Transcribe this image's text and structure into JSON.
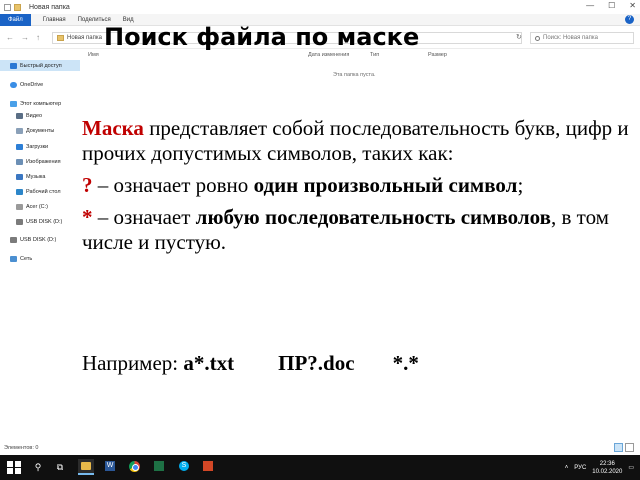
{
  "window": {
    "title": "Новая папка",
    "controls": {
      "minimize": "—",
      "maximize": "☐",
      "close": "✕"
    }
  },
  "ribbon": {
    "tabs": [
      "Файл",
      "Главная",
      "Поделиться",
      "Вид"
    ],
    "help": "?"
  },
  "address": {
    "path": "Новая папка",
    "search_placeholder": "Поиск: Новая папка"
  },
  "navpane": {
    "items": [
      {
        "label": "Быстрый доступ",
        "icon": "star-icon",
        "selected": true
      },
      {
        "label": "OneDrive",
        "icon": "cloud-icon"
      },
      {
        "label": "Этот компьютер",
        "icon": "computer-icon"
      },
      {
        "label": "Видео",
        "icon": "video-icon"
      },
      {
        "label": "Документы",
        "icon": "documents-icon"
      },
      {
        "label": "Загрузки",
        "icon": "downloads-icon"
      },
      {
        "label": "Изображения",
        "icon": "pictures-icon"
      },
      {
        "label": "Музыка",
        "icon": "music-icon"
      },
      {
        "label": "Рабочий стол",
        "icon": "desktop-icon"
      },
      {
        "label": "Acer (C:)",
        "icon": "disk-icon"
      },
      {
        "label": "USB DISK (D:)",
        "icon": "usb-icon"
      },
      {
        "label": "USB DISK (D:)",
        "icon": "usb-icon"
      },
      {
        "label": "Сеть",
        "icon": "network-icon"
      }
    ]
  },
  "filelist": {
    "columns": [
      "Имя",
      "Дата изменения",
      "Тип",
      "Размер"
    ],
    "empty_message": "Эта папка пуста."
  },
  "statusbar": {
    "text": "Элементов: 0"
  },
  "taskbar": {
    "tray_lang": "РУС",
    "time": "22:36",
    "date": "10.02.2020"
  },
  "slide": {
    "title": "Поиск файла по маске",
    "para1_term": "Маска",
    "para1_text": " представляет собой последовательность букв, цифр и прочих допустимых символов, таких как:",
    "para2_symbol": "?",
    "para2_text": " – означает ровно ",
    "para2_bold": "один произвольный символ",
    "para2_end": ";",
    "para3_symbol": "*",
    "para3_text": " – означает  ",
    "para3_bold": "любую последовательность символов",
    "para3_end": ", в том числе и пустую.",
    "example_label": "Например: ",
    "examples": [
      "a*.txt",
      "ПР?.doc",
      "*.*"
    ]
  },
  "colors": {
    "accent": "#1a63c6",
    "highlight": "#c00000",
    "selection": "#cce4f7",
    "taskbar": "#101010"
  }
}
